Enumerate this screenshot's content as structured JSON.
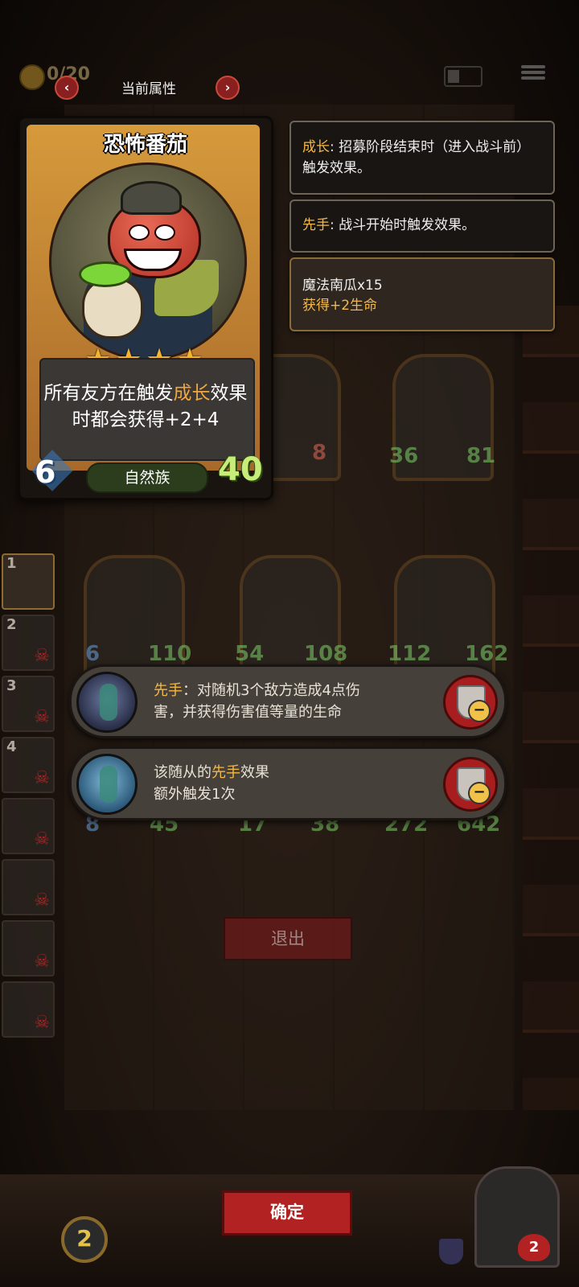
{
  "topbar": {
    "coins": "0/20",
    "attr_title": "当前属性",
    "prev_label": "‹",
    "next_label": "›"
  },
  "card": {
    "name": "恐怖番茄",
    "stars": "★★★★",
    "desc_prefix": "所有友方在触发",
    "desc_keyword": "成长",
    "desc_suffix": "效果时都会获得+2+4",
    "cost": "6",
    "tribe": "自然族",
    "hp": "40"
  },
  "keywords": [
    {
      "keyword": "成长",
      "text": ": 招募阶段结束时（进入战斗前）触发效果。"
    },
    {
      "keyword": "先手",
      "text": ": 战斗开始时触发效果。"
    }
  ],
  "buff": {
    "source": "魔法南瓜x15",
    "effect": "获得+2生命"
  },
  "board_stats": {
    "row1": [
      {
        "atk": "",
        "hp": "8"
      },
      {
        "atk": "36",
        "hp": "81"
      }
    ],
    "row2": [
      {
        "atk": "6",
        "hp": "110"
      },
      {
        "atk": "54",
        "hp": "108"
      },
      {
        "atk": "112",
        "hp": "162"
      }
    ],
    "row3": [
      {
        "atk": "8",
        "hp": "45"
      },
      {
        "atk": "17",
        "hp": "38"
      },
      {
        "atk": "272",
        "hp": "642"
      }
    ]
  },
  "roster": [
    "1",
    "2",
    "3",
    "4",
    "",
    "",
    "",
    ""
  ],
  "abilities": [
    {
      "keyword": "先手",
      "text_line1": "：对随机3个敌方造成4点伤",
      "text_line2": "害，并获得伤害值等量的生命"
    },
    {
      "prefix": "该随从的",
      "keyword": "先手",
      "suffix": "效果",
      "line2": "额外触发1次"
    }
  ],
  "buttons": {
    "exit": "退出",
    "confirm": "确定"
  },
  "bottom": {
    "coin_count": "2",
    "hero_hp": "2"
  }
}
